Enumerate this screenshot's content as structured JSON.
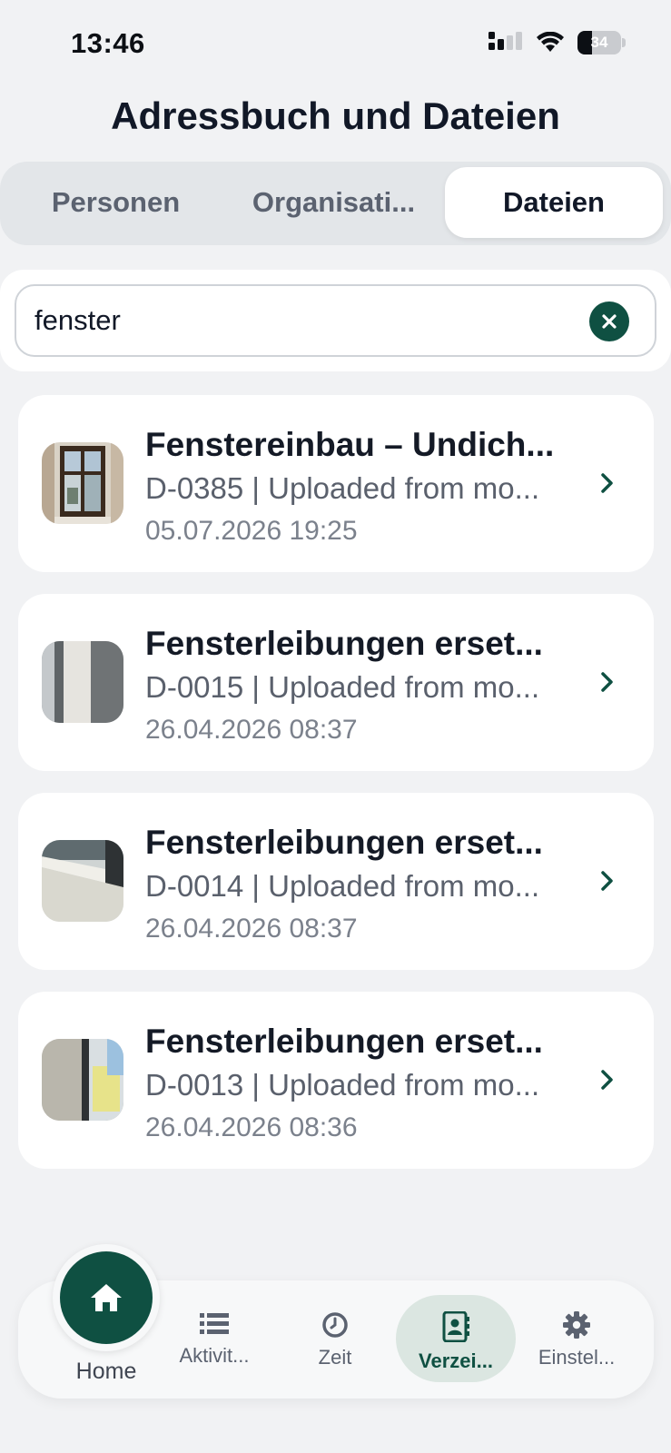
{
  "status_bar": {
    "time": "13:46",
    "battery": "34",
    "battery_level": 0.34
  },
  "header": {
    "title": "Adressbuch und Dateien"
  },
  "tabs": [
    {
      "label": "Personen",
      "selected": false
    },
    {
      "label": "Organisati...",
      "selected": false
    },
    {
      "label": "Dateien",
      "selected": true
    }
  ],
  "search": {
    "value": "fenster",
    "placeholder": ""
  },
  "files": [
    {
      "title": "Fenstereinbau – Undich...",
      "subtitle": "D-0385 | Uploaded from mo...",
      "date": "05.07.2026 19:25",
      "thumb": "window-photo"
    },
    {
      "title": "Fensterleibungen erset...",
      "subtitle": "D-0015 | Uploaded from mo...",
      "date": "26.04.2026 08:37",
      "thumb": "wall-photo"
    },
    {
      "title": "Fensterleibungen erset...",
      "subtitle": "D-0014 | Uploaded from mo...",
      "date": "26.04.2026 08:37",
      "thumb": "ceiling-photo"
    },
    {
      "title": "Fensterleibungen erset...",
      "subtitle": "D-0013 | Uploaded from mo...",
      "date": "26.04.2026 08:36",
      "thumb": "window-frame-photo"
    }
  ],
  "bottom_nav": {
    "home": {
      "label": "Home",
      "icon": "home-icon"
    },
    "items": [
      {
        "label": "Aktivit...",
        "icon": "list-icon",
        "active": false
      },
      {
        "label": "Zeit",
        "icon": "clock-icon",
        "active": false
      },
      {
        "label": "Verzei...",
        "icon": "contacts-book-icon",
        "active": true
      },
      {
        "label": "Einstel...",
        "icon": "gear-icon",
        "active": false
      }
    ]
  },
  "colors": {
    "accent": "#0f5042",
    "background": "#f1f2f4",
    "card": "#ffffff",
    "active_nav_bg": "#dbe6e1"
  }
}
